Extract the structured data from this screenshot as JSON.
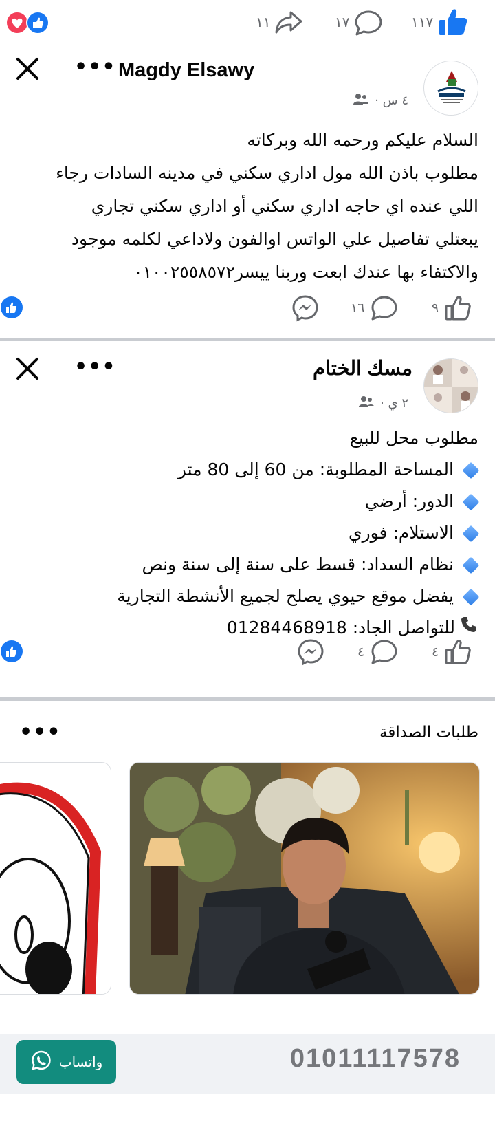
{
  "top_bar": {
    "likes_count": "١١٧",
    "comments_count": "١٧",
    "shares_count": "١١"
  },
  "post1": {
    "author": "Magdy Elsawy",
    "time": "٤ س ·",
    "lines": [
      "السلام عليكم ورحمه الله وبركاته",
      "مطلوب باذن الله مول اداري سكني في مدينه السادات رجاء",
      "اللي عنده اي حاجه اداري سكني أو اداري سكني تجاري",
      "يبعتلي تفاصيل علي الواتس اوالفون ولاداعي لكلمه موجود",
      "والاكتفاء بها عندك ابعت وربنا ييسر٠١٠٠٢٥٥٨٥٧٢"
    ],
    "likes": "٩",
    "comments": "١٦"
  },
  "post2": {
    "author": "مسك الختام",
    "time": "٢ ي ·",
    "title": "مطلوب محل للبيع",
    "bullets": [
      "المساحة المطلوبة: من 60 إلى 80 متر",
      "الدور: أرضي",
      "الاستلام: فوري",
      "نظام السداد: قسط على سنة إلى سنة ونص",
      "يفضل موقع حيوي يصلح لجميع الأنشطة التجارية"
    ],
    "contact": "للتواصل الجاد: 01284468918",
    "likes": "٤",
    "comments": "٤"
  },
  "friends": {
    "title": "طلبات الصداقة"
  },
  "bottom": {
    "whatsapp_label": "واتساب",
    "phone": "01011117578"
  },
  "colors": {
    "fb_blue": "#1877f2",
    "whatsapp_green": "#128c7e",
    "divider": "#c9ccd1"
  }
}
